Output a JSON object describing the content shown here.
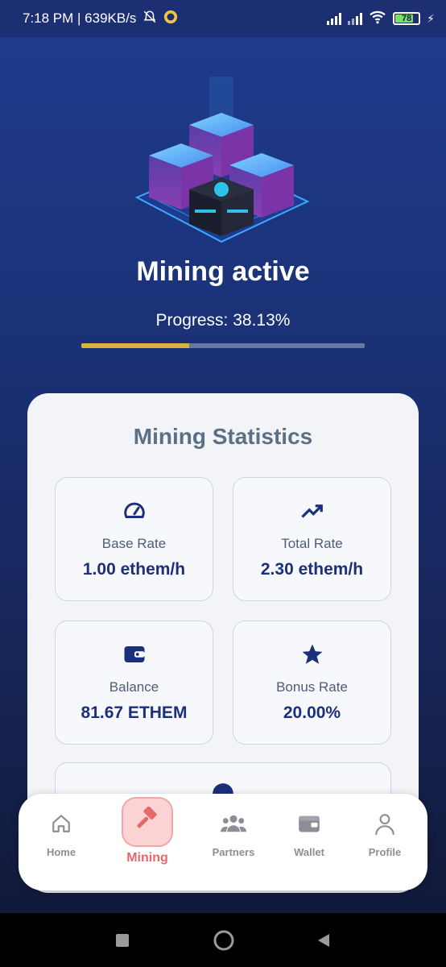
{
  "status_bar": {
    "time_speed": "7:18 PM | 639KB/s",
    "battery": "78"
  },
  "hero": {
    "title": "Mining active",
    "progress_label": "Progress: 38.13%",
    "progress_value": 0.3813,
    "progress_color": "#d8b23a"
  },
  "stats": {
    "title": "Mining Statistics",
    "items": [
      {
        "icon": "speedometer-icon",
        "label": "Base Rate",
        "value": "1.00 ethem/h"
      },
      {
        "icon": "trending-up-icon",
        "label": "Total Rate",
        "value": "2.30 ethem/h"
      },
      {
        "icon": "wallet-icon",
        "label": "Balance",
        "value": "81.67 ETHEM"
      },
      {
        "icon": "star-icon",
        "label": "Bonus Rate",
        "value": "20.00%"
      }
    ]
  },
  "nav": {
    "items": [
      {
        "icon": "home-icon",
        "label": "Home"
      },
      {
        "icon": "hammer-icon",
        "label": "Mining",
        "active": true
      },
      {
        "icon": "people-icon",
        "label": "Partners"
      },
      {
        "icon": "wallet-icon",
        "label": "Wallet"
      },
      {
        "icon": "person-icon",
        "label": "Profile"
      }
    ],
    "active_color": "#e46a6a"
  }
}
